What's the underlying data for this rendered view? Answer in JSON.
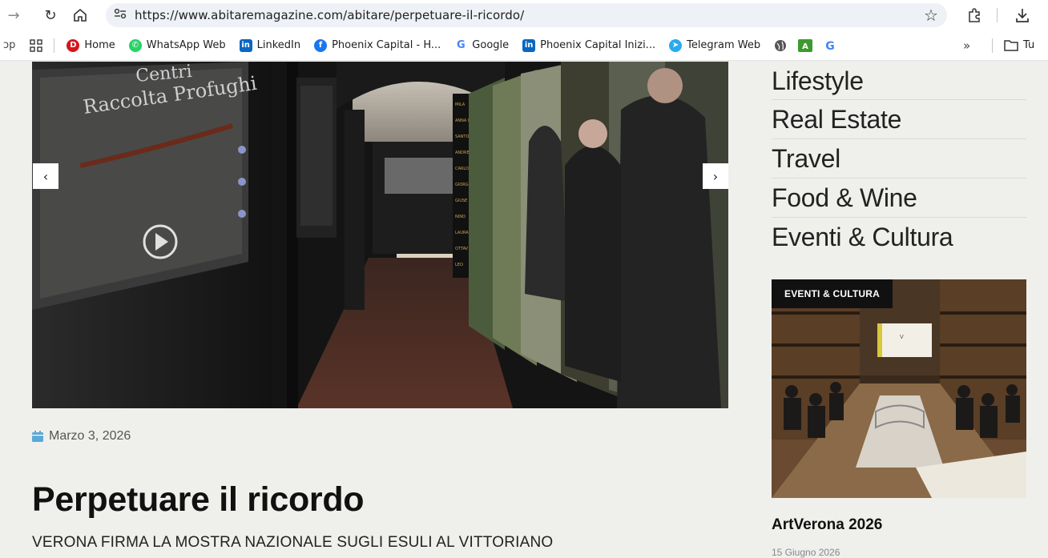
{
  "browser": {
    "url": "https://www.abitaremagazine.com/abitare/perpetuare-il-ricordo/",
    "leading_text": "ɔp",
    "bookmarks": [
      {
        "label": "Home",
        "color": "#d3161b",
        "glyph": "D"
      },
      {
        "label": "WhatsApp Web",
        "color": "#25d366",
        "glyph": "✆"
      },
      {
        "label": "LinkedIn",
        "color": "#0a66c2",
        "glyph": "in"
      },
      {
        "label": "Phoenix Capital - H...",
        "color": "#1877f2",
        "glyph": "f"
      },
      {
        "label": "Google",
        "color": "#ffffff",
        "glyph": "G"
      },
      {
        "label": "Phoenix Capital Inizi...",
        "color": "#0a66c2",
        "glyph": "in"
      },
      {
        "label": "Telegram Web",
        "color": "#2aabee",
        "glyph": "➤"
      }
    ],
    "overflow_label": "»",
    "folder_label": "Tu"
  },
  "hero": {
    "image_text_line1": "Centri",
    "image_text_line2": "Raccolta Profughi",
    "prev_label": "‹",
    "next_label": "›"
  },
  "article": {
    "date": "Marzo 3, 2026",
    "title": "Perpetuare il ricordo",
    "subtitle": "VERONA FIRMA LA MOSTRA NAZIONALE SUGLI ESULI AL VITTORIANO"
  },
  "sidebar": {
    "categories": [
      "Lifestyle",
      "Real Estate",
      "Travel",
      "Food & Wine",
      "Eventi & Cultura"
    ],
    "card": {
      "tag": "EVENTI & CULTURA",
      "title": "ArtVerona 2026",
      "date": "15 Giugno 2026"
    }
  },
  "colors": {
    "page_bg": "#efefec",
    "calendar_icon": "#5aa9d6"
  }
}
